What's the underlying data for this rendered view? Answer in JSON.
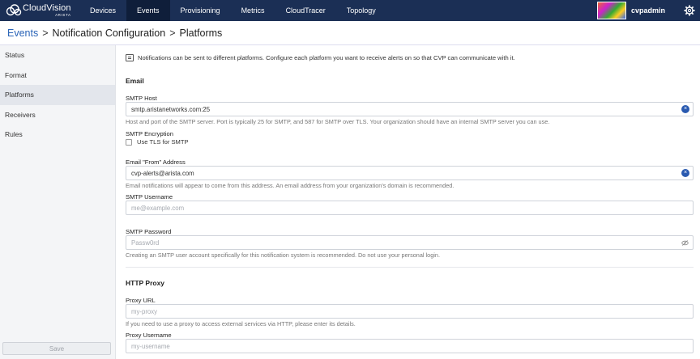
{
  "app": {
    "brand": "CloudVision",
    "brand_sub": "ARISTA"
  },
  "nav": [
    "Devices",
    "Events",
    "Provisioning",
    "Metrics",
    "CloudTracer",
    "Topology"
  ],
  "user": {
    "name": "cvpadmin"
  },
  "breadcrumb": {
    "root": "Events",
    "sep1": ">",
    "mid": "Notification Configuration",
    "sep2": ">",
    "current": "Platforms"
  },
  "sidebar": {
    "items": [
      "Status",
      "Format",
      "Platforms",
      "Receivers",
      "Rules"
    ],
    "save_label": "Save"
  },
  "main": {
    "info": "Notifications can be sent to different platforms. Configure each platform you want to receive alerts on so that CVP can communicate with it.",
    "email": {
      "title": "Email",
      "smtp_host_label": "SMTP Host",
      "smtp_host_value": "smtp.aristanetworks.com:25",
      "smtp_host_help": "Host and port of the SMTP server. Port is typically 25 for SMTP, and 587 for SMTP over TLS. Your organization should have an internal SMTP server you can use.",
      "encryption_label": "SMTP Encryption",
      "tls_label": "Use TLS for SMTP",
      "from_label": "Email \"From\" Address",
      "from_value": "cvp-alerts@arista.com",
      "from_help": "Email notifications will appear to come from this address. An email address from your organization's domain is recommended.",
      "username_label": "SMTP Username",
      "username_placeholder": "me@example.com",
      "password_label": "SMTP Password",
      "password_placeholder": "Passw0rd",
      "password_help": "Creating an SMTP user account specifically for this notification system is recommended. Do not use your personal login."
    },
    "proxy": {
      "title": "HTTP Proxy",
      "url_label": "Proxy URL",
      "url_placeholder": "my-proxy",
      "url_help": "If you need to use a proxy to access external services via HTTP, please enter its details.",
      "username_label": "Proxy Username",
      "username_placeholder": "my-username"
    }
  }
}
